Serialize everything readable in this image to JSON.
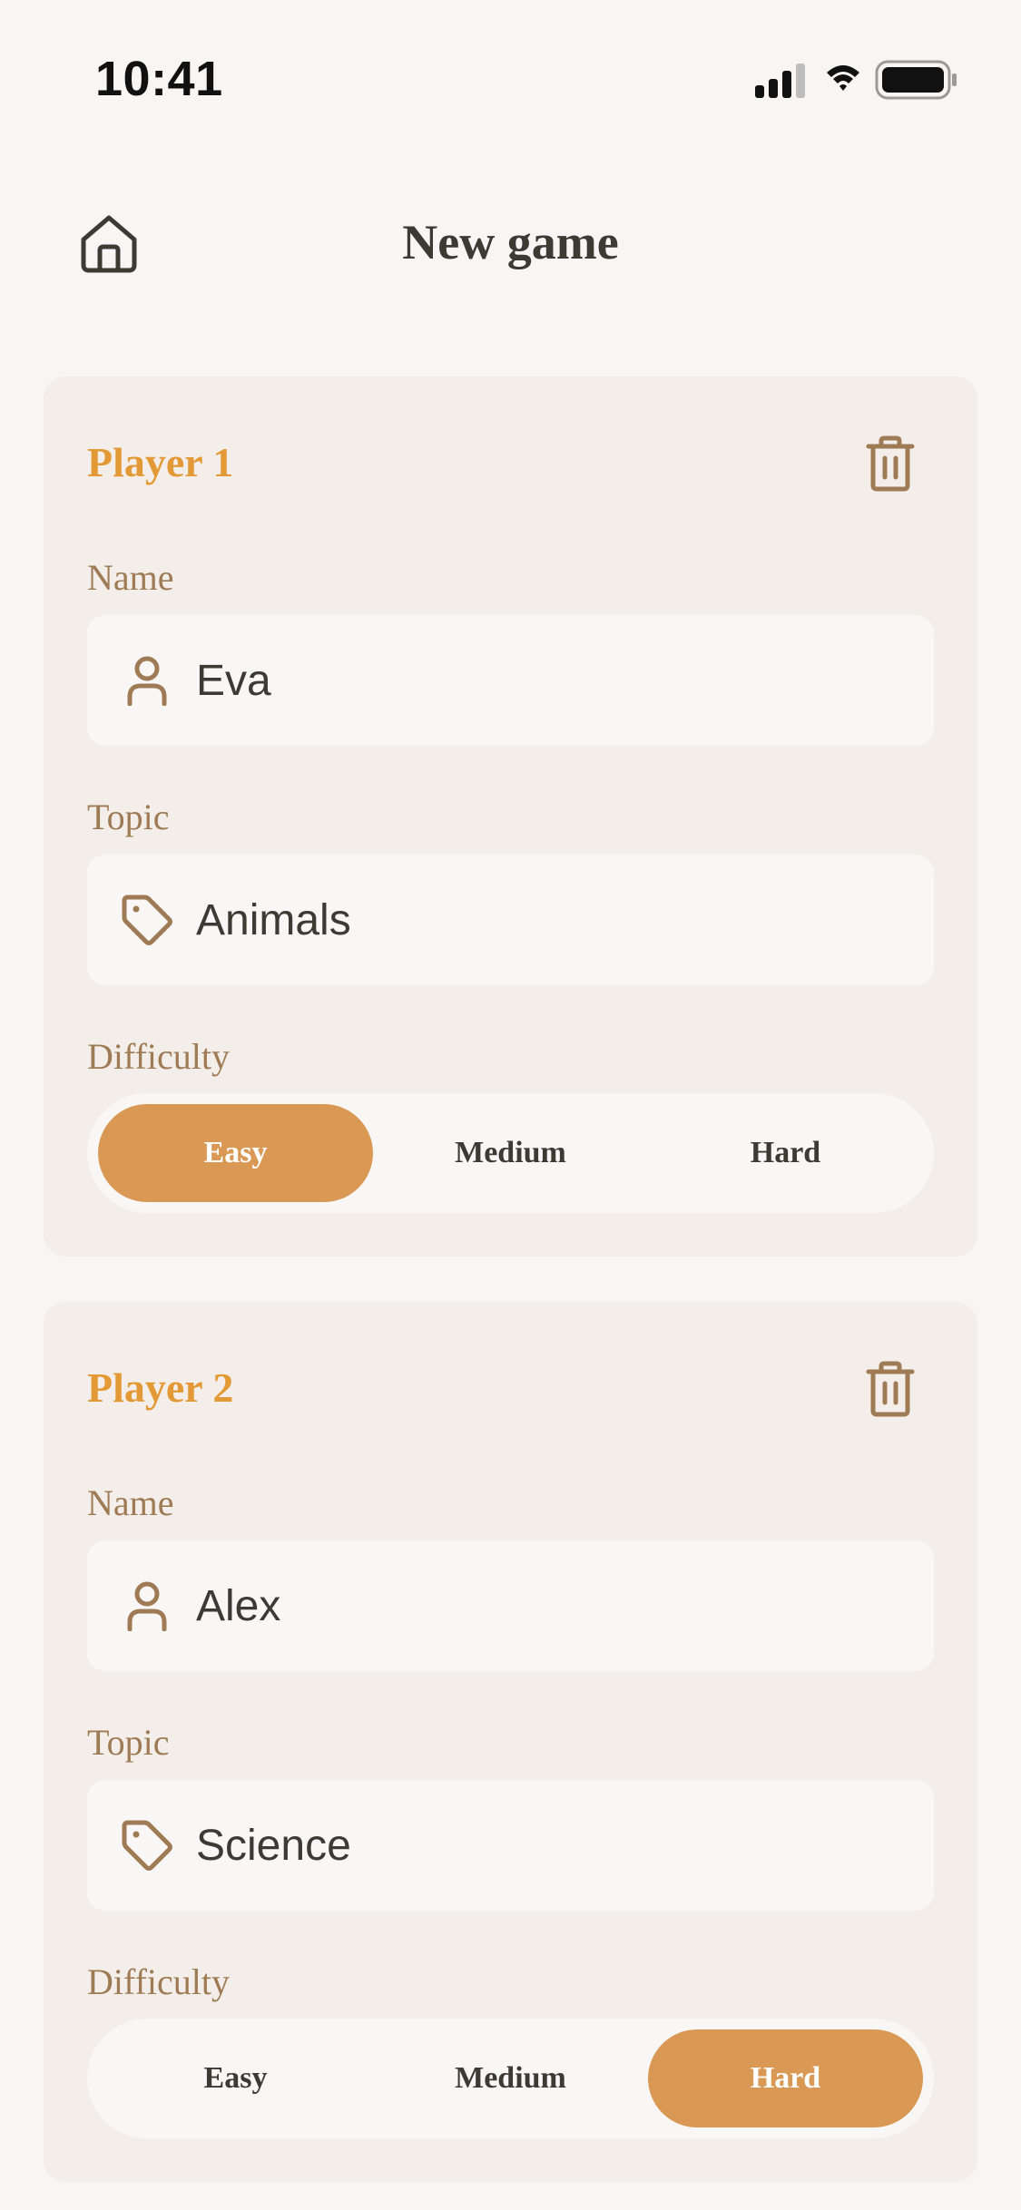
{
  "status_bar": {
    "time": "10:41"
  },
  "header": {
    "title": "New game",
    "home_icon": "home-icon"
  },
  "colors": {
    "accent": "#d99955",
    "player_title": "#e39a36",
    "label": "#9e7b55",
    "card_bg": "#f3eee9",
    "page_bg": "#f8f6f4",
    "text": "#3d3a34"
  },
  "players": [
    {
      "title": "Player 1",
      "name_label": "Name",
      "name_value": "Eva",
      "topic_label": "Topic",
      "topic_value": "Animals",
      "difficulty_label": "Difficulty",
      "difficulty_options": [
        "Easy",
        "Medium",
        "Hard"
      ],
      "selected_difficulty": "Easy"
    },
    {
      "title": "Player 2",
      "name_label": "Name",
      "name_value": "Alex",
      "topic_label": "Topic",
      "topic_value": "Science",
      "difficulty_label": "Difficulty",
      "difficulty_options": [
        "Easy",
        "Medium",
        "Hard"
      ],
      "selected_difficulty": "Hard"
    }
  ]
}
